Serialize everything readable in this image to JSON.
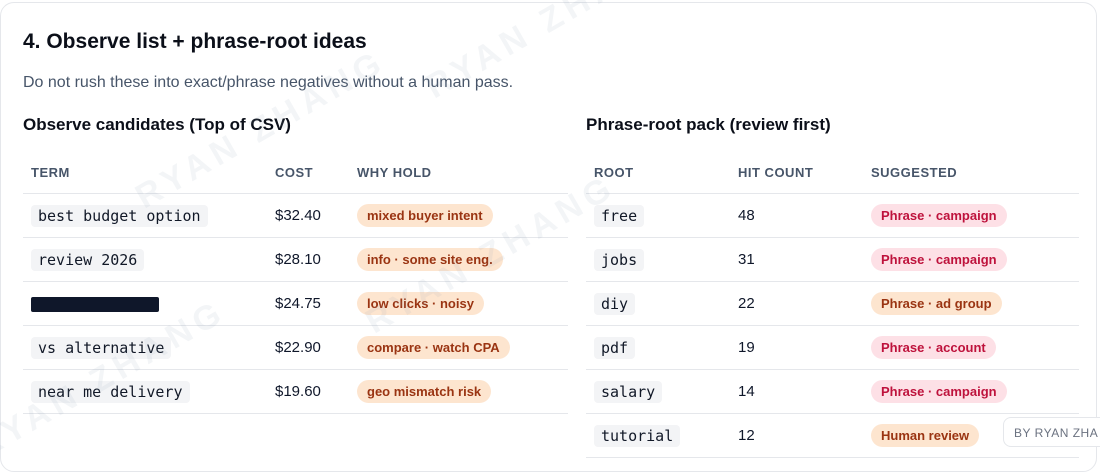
{
  "section": {
    "title": "4. Observe list + phrase-root ideas",
    "subtitle": "Do not rush these into exact/phrase negatives without a human pass."
  },
  "observe": {
    "heading": "Observe candidates (Top of CSV)",
    "columns": [
      "TERM",
      "COST",
      "WHY HOLD"
    ],
    "rows": [
      {
        "term": "best budget option",
        "redacted": false,
        "cost": "$32.40",
        "why": "mixed buyer intent"
      },
      {
        "term": "review 2026",
        "redacted": false,
        "cost": "$28.10",
        "why": "info · some site eng."
      },
      {
        "term": "",
        "redacted": true,
        "cost": "$24.75",
        "why": "low clicks · noisy"
      },
      {
        "term": "vs alternative",
        "redacted": false,
        "cost": "$22.90",
        "why": "compare · watch CPA"
      },
      {
        "term": "near me delivery",
        "redacted": false,
        "cost": "$19.60",
        "why": "geo mismatch risk"
      }
    ]
  },
  "phrase_root": {
    "heading": "Phrase-root pack (review first)",
    "columns": [
      "ROOT",
      "HIT COUNT",
      "SUGGESTED"
    ],
    "rows": [
      {
        "root": "free",
        "hits": "48",
        "suggested": "Phrase · campaign",
        "tone": "pink"
      },
      {
        "root": "jobs",
        "hits": "31",
        "suggested": "Phrase · campaign",
        "tone": "pink"
      },
      {
        "root": "diy",
        "hits": "22",
        "suggested": "Phrase · ad group",
        "tone": "orange"
      },
      {
        "root": "pdf",
        "hits": "19",
        "suggested": "Phrase · account",
        "tone": "pink"
      },
      {
        "root": "salary",
        "hits": "14",
        "suggested": "Phrase · campaign",
        "tone": "pink"
      },
      {
        "root": "tutorial",
        "hits": "12",
        "suggested": "Human review",
        "tone": "orange"
      }
    ]
  },
  "byline": "BY RYAN ZHA",
  "watermark": "RYAN ZHANG"
}
